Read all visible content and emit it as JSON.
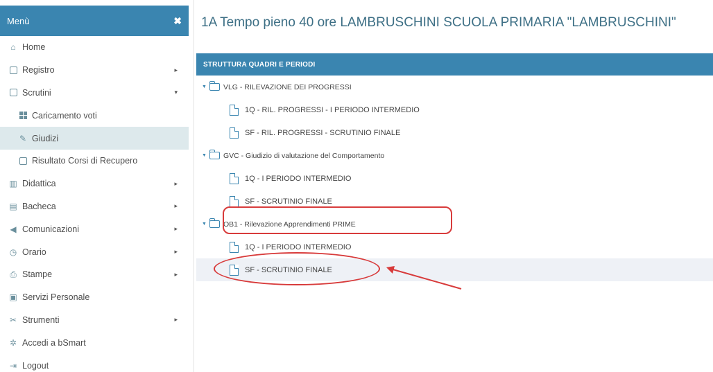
{
  "sidebar": {
    "header": {
      "title": "Menù",
      "close": "✖"
    },
    "items": [
      {
        "label": "Home",
        "icon": "home-icon",
        "arrow": ""
      },
      {
        "label": "Registro",
        "icon": "calendar-icon",
        "arrow": "▸"
      },
      {
        "label": "Scrutini",
        "icon": "document-icon",
        "arrow": "▾"
      },
      {
        "label": "Caricamento voti",
        "icon": "grid-icon",
        "arrow": ""
      },
      {
        "label": "Giudizi",
        "icon": "edit-icon",
        "arrow": ""
      },
      {
        "label": "Risultato Corsi di Recupero",
        "icon": "document-icon",
        "arrow": ""
      },
      {
        "label": "Didattica",
        "icon": "book-icon",
        "arrow": "▸"
      },
      {
        "label": "Bacheca",
        "icon": "board-icon",
        "arrow": "▸"
      },
      {
        "label": "Comunicazioni",
        "icon": "megaphone-icon",
        "arrow": "▸"
      },
      {
        "label": "Orario",
        "icon": "clock-icon",
        "arrow": "▸"
      },
      {
        "label": "Stampe",
        "icon": "printer-icon",
        "arrow": "▸"
      },
      {
        "label": "Servizi Personale",
        "icon": "briefcase-icon",
        "arrow": ""
      },
      {
        "label": "Strumenti",
        "icon": "tools-icon",
        "arrow": "▸"
      },
      {
        "label": "Accedi a bSmart",
        "icon": "star-icon",
        "arrow": ""
      },
      {
        "label": "Logout",
        "icon": "logout-icon",
        "arrow": ""
      }
    ]
  },
  "main": {
    "title": "1A Tempo pieno 40 ore LAMBRUSCHINI SCUOLA PRIMARIA \"LAMBRUSCHINI\"",
    "panel_title": "STRUTTURA QUADRI E PERIODI",
    "tree": [
      {
        "label": "VLG - RILEVAZIONE DEI PROGRESSI",
        "toggle": "▼"
      },
      {
        "label": "1Q - RIL. PROGRESSI - I PERIODO INTERMEDIO"
      },
      {
        "label": "SF - RIL. PROGRESSI - SCRUTINIO FINALE"
      },
      {
        "label": "GVC - Giudizio di valutazione del Comportamento",
        "toggle": "▼"
      },
      {
        "label": "1Q - I PERIODO INTERMEDIO"
      },
      {
        "label": "SF - SCRUTINIO FINALE"
      },
      {
        "label": "OB1 - Rilevazione Apprendimenti PRIME",
        "toggle": "▼"
      },
      {
        "label": "1Q - I PERIODO INTERMEDIO"
      },
      {
        "label": "SF - SCRUTINIO FINALE"
      }
    ]
  },
  "colors": {
    "accent": "#3a85b0",
    "active_bg": "#dde9ec",
    "annotation": "#d83b3b"
  }
}
